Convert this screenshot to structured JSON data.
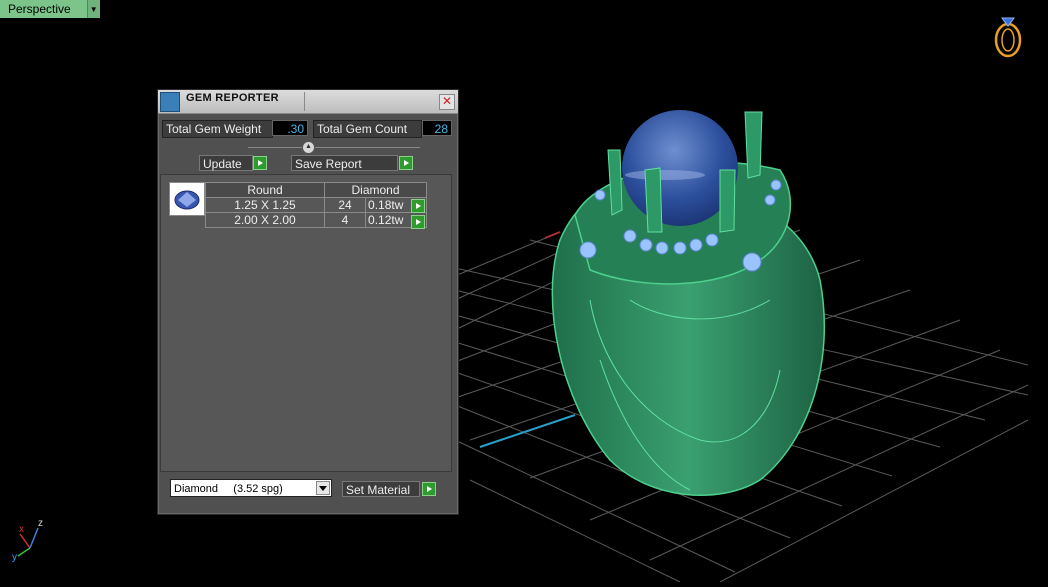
{
  "viewport": {
    "label": "Perspective"
  },
  "axis": {
    "x": "x",
    "y": "y",
    "z": "z"
  },
  "panel": {
    "title": "GEM REPORTER",
    "total_gem_weight_label": "Total Gem Weight",
    "total_gem_weight_value": ".30",
    "total_gem_count_label": "Total Gem Count",
    "total_gem_count_value": "28",
    "update_label": "Update",
    "save_report_label": "Save Report",
    "table": {
      "headers": [
        "Round",
        "Diamond"
      ],
      "rows": [
        {
          "size": "1.25 X 1.25",
          "count": "24",
          "weight": "0.18tw"
        },
        {
          "size": "2.00 X 2.00",
          "count": "4",
          "weight": "0.12tw"
        }
      ]
    },
    "material_select": "Diamond     (3.52 spg)",
    "set_material_label": "Set Material"
  },
  "colors": {
    "grid": "#5a5a5a",
    "model": "#2d8a5e",
    "stone": "#2c4f9c",
    "go_button": "#2f9b2f",
    "value_text": "#45b8e8"
  }
}
